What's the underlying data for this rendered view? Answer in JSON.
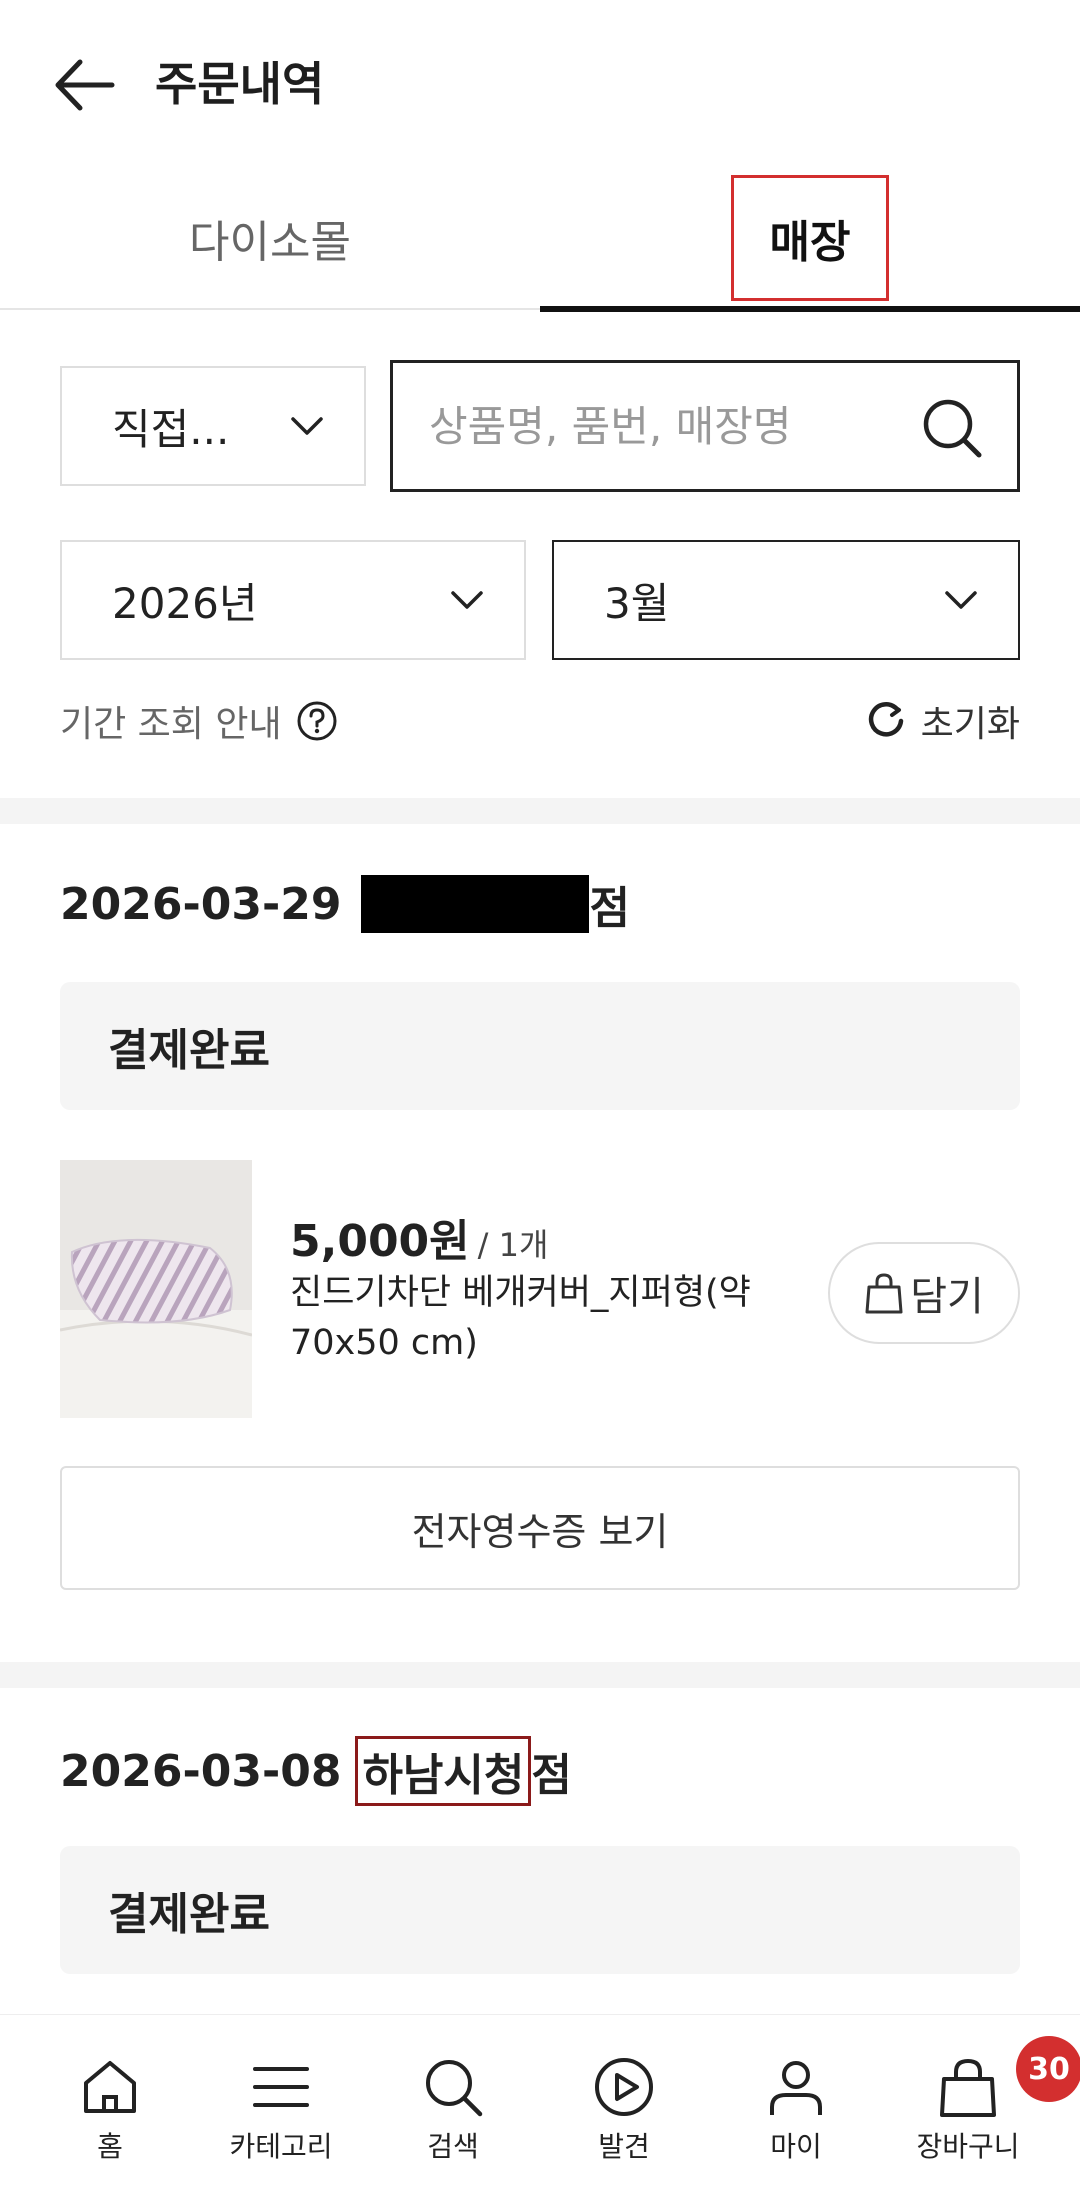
{
  "header": {
    "title": "주문내역"
  },
  "tabs": [
    {
      "label": "다이소몰"
    },
    {
      "label": "매장"
    }
  ],
  "filters": {
    "type_select": "직접...",
    "search_placeholder": "상품명, 품번, 매장명",
    "year_select": "2026년",
    "month_select": "3월",
    "period_info": "기간 조회 안내",
    "reset": "초기화"
  },
  "orders": [
    {
      "date": "2026-03-29",
      "store_suffix": "점",
      "status": "결제완료",
      "item": {
        "price": "5,000원",
        "qty": "/ 1개",
        "name": "진드기차단 베개커버_지퍼형(약 70x50 cm)",
        "cart_label": "담기"
      },
      "receipt_label": "전자영수증 보기"
    },
    {
      "date": "2026-03-08",
      "store_name": "하남시청",
      "store_suffix": "점",
      "status": "결제완료"
    }
  ],
  "bottom_nav": [
    {
      "label": "홈",
      "icon": "home-icon"
    },
    {
      "label": "카테고리",
      "icon": "menu-icon"
    },
    {
      "label": "검색",
      "icon": "search-icon"
    },
    {
      "label": "발견",
      "icon": "play-icon"
    },
    {
      "label": "마이",
      "icon": "user-icon"
    },
    {
      "label": "장바구니",
      "icon": "bag-icon"
    }
  ],
  "cart_badge": "30",
  "colors": {
    "accent_red": "#d32f2f",
    "text_dark": "#222222",
    "border_light": "#dedede"
  }
}
